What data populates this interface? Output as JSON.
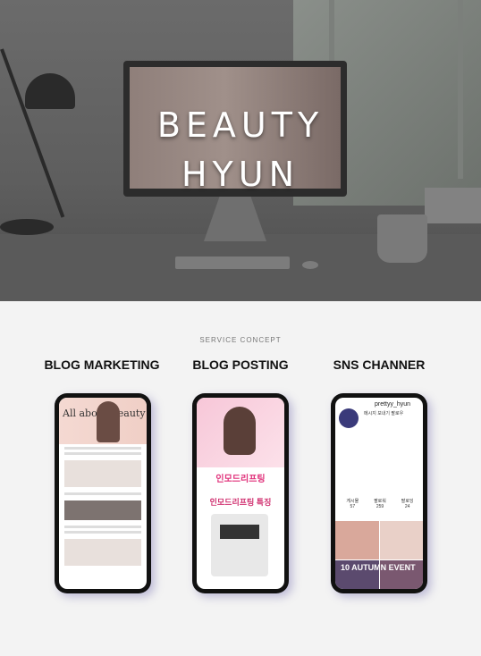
{
  "hero": {
    "title_line1": "BEAUTY",
    "title_line2": "HYUN"
  },
  "section": {
    "label": "SERVICE CONCEPT"
  },
  "columns": [
    {
      "title": "BLOG MARKETING",
      "big_text": "All about Beauty"
    },
    {
      "title": "BLOG POSTING",
      "pink_text_1": "인모드리프팅",
      "pink_text_2": "인모드리프팅 특징"
    },
    {
      "title": "SNS CHANNER",
      "username": "prettyy_hyun",
      "buttons": "메시지 보내기  팔로우",
      "stats": [
        "게시물",
        "팔로워",
        "팔로잉"
      ],
      "stat_values": [
        "57",
        "259",
        "24"
      ],
      "promo": "10 AUTUMN EVENT"
    }
  ]
}
